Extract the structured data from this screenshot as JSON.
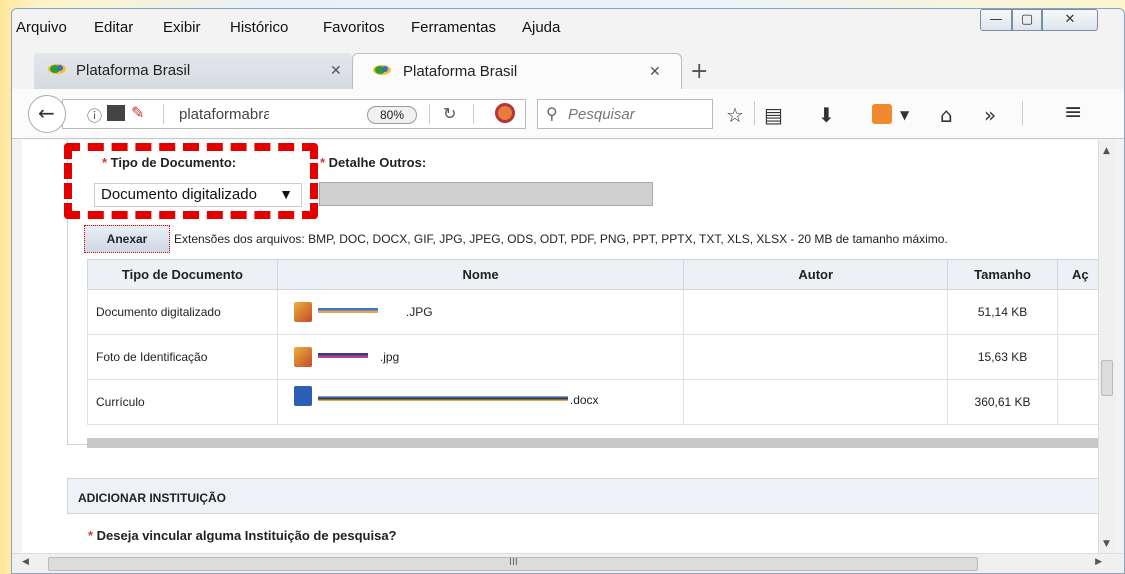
{
  "menu": {
    "items": [
      "Arquivo",
      "Editar",
      "Exibir",
      "Histórico",
      "Favoritos",
      "Ferramentas",
      "Ajuda"
    ]
  },
  "window_controls": {
    "minimize": "—",
    "maximize": "▢",
    "close": "✕"
  },
  "tabs": [
    {
      "label": "Plataforma Brasil",
      "active": false
    },
    {
      "label": "Plataforma Brasil",
      "active": true
    }
  ],
  "new_tab": "+",
  "navbar": {
    "url": "plataformabrasil.sa",
    "zoom": "80%",
    "search_placeholder": "Pesquisar"
  },
  "form": {
    "tipo_label": "Tipo de Documento:",
    "tipo_value": "Documento digitalizado",
    "detalhe_label": "Detalhe Outros:",
    "anexar_label": "Anexar",
    "extensions_text": "Extensões dos arquivos: BMP, DOC, DOCX, GIF, JPG, JPEG, ODS, ODT, PDF, PNG, PPT, PPTX, TXT, XLS, XLSX - 20 MB de tamanho máximo."
  },
  "table": {
    "headers": [
      "Tipo de Documento",
      "Nome",
      "Autor",
      "Tamanho",
      "Aç"
    ],
    "rows": [
      {
        "tipo": "Documento digitalizado",
        "ext": ".JPG",
        "autor": "",
        "tamanho": "51,14 KB"
      },
      {
        "tipo": "Foto de Identificação",
        "ext": ".jpg",
        "autor": "",
        "tamanho": "15,63 KB"
      },
      {
        "tipo": "Currículo",
        "ext": ".docx",
        "autor": "",
        "tamanho": "360,61 KB"
      }
    ]
  },
  "instituicao": {
    "header": "ADICIONAR INSTITUIÇÃO",
    "question": "Deseja vincular alguma Instituição de pesquisa?"
  },
  "hscroll_label": "III",
  "colors": {
    "highlight": "#e50000",
    "required": "#d33333"
  }
}
